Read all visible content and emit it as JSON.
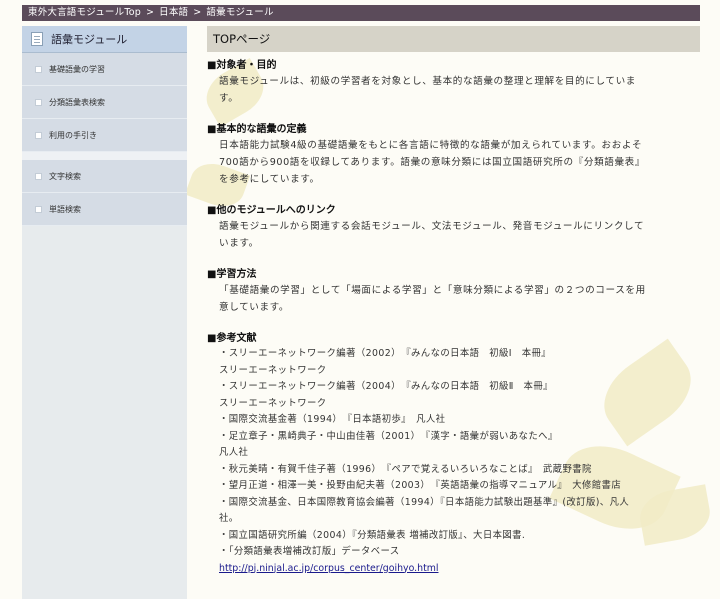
{
  "breadcrumb": {
    "home": "東外大言語モジュールTop",
    "lang": "日本語",
    "current": "語彙モジュール",
    "separator": ">"
  },
  "sidebar": {
    "title": "語彙モジュール",
    "items": [
      {
        "label": "基礎語彙の学習"
      },
      {
        "label": "分類語彙表検索"
      },
      {
        "label": "利用の手引き"
      },
      {
        "label": "文字検索"
      },
      {
        "label": "単語検索"
      }
    ]
  },
  "main": {
    "title": "TOPページ",
    "sections": [
      {
        "heading": "■対象者・目的",
        "lines": [
          "語彙モジュールは、初級の学習者を対象とし、基本的な語彙の整理と理解を目的にしていま",
          "す。"
        ]
      },
      {
        "heading": "■基本的な語彙の定義",
        "lines": [
          "日本語能力試験4級の基礎語彙をもとに各言語に特徴的な語彙が加えられています。おおよそ",
          "700語から900語を収録してあります。語彙の意味分類には国立国語研究所の『分類語彙表』",
          "を参考にしています。"
        ]
      },
      {
        "heading": "■他のモジュールへのリンク",
        "lines": [
          "語彙モジュールから関連する会話モジュール、文法モジュール、発音モジュールにリンクして",
          "います。"
        ]
      },
      {
        "heading": "■学習方法",
        "lines": [
          "「基礎語彙の学習」として「場面による学習」と「意味分類による学習」の２つのコースを用",
          "意しています。"
        ]
      }
    ],
    "references": {
      "heading": "■参考文献",
      "lines": [
        "・スリーエーネットワーク編著（2002）　『みんなの日本語　初級Ⅰ　本冊』",
        "スリーエーネットワーク",
        "・スリーエーネットワーク編著（2004）　『みんなの日本語　初級Ⅱ　本冊』",
        "スリーエーネットワーク",
        "・国際交流基金著（1994）　『日本語初歩』　凡人社",
        "・足立章子・黒崎典子・中山由佳著（2001）　『漢字・語彙が弱いあなたへ』",
        "凡人社",
        "・秋元美晴・有賀千佳子著（1996）　『ペアで覚えるいろいろなことば』　武蔵野書院",
        "・望月正道・相澤一美・投野由紀夫著（2003）　『英語語彙の指導マニュアル』　大修館書店",
        "・国際交流基金、日本国際教育協会編著（1994）『日本語能力試験出題基準』(改訂版)、凡人",
        "社。",
        "・国立国語研究所編（2004）『分類語彙表 増補改訂版』、大日本図書.",
        "・「分類語彙表増補改訂版」データベース"
      ],
      "link": "http://pj.ninjal.ac.jp/corpus_center/goihyo.html"
    }
  }
}
